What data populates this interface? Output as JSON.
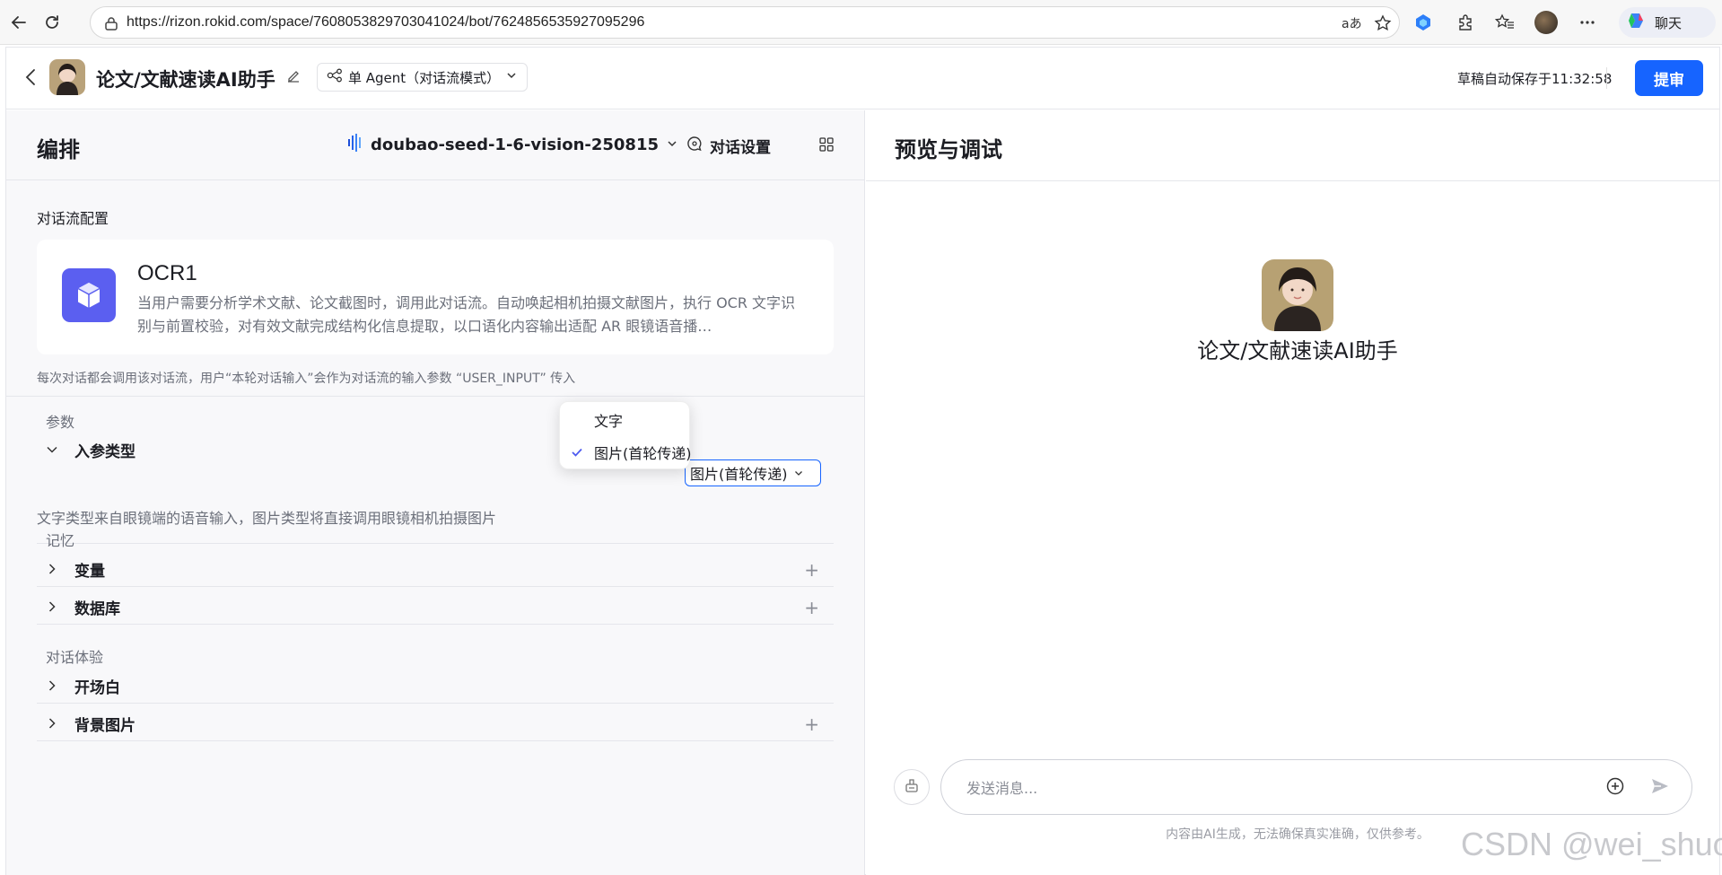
{
  "browser": {
    "url": "https://rizon.rokid.com/space/7608053829703041024/bot/7624856535927095296",
    "chat_label": "聊天"
  },
  "header": {
    "bot_title": "论文/文献速读AI助手",
    "mode": "单 Agent（对话流模式）",
    "autosave": "草稿自动保存于11:32:58",
    "submit_label": "提审"
  },
  "left": {
    "title": "编排",
    "model": "doubao-seed-1-6-vision-250815",
    "dialog_settings": "对话设置",
    "flow_section": "对话流配置",
    "flow": {
      "name": "OCR1",
      "description": "当用户需要分析学术文献、论文截图时，调用此对话流。自动唤起相机拍摄文献图片，执行 OCR 文字识别与前置校验，对有效文献完成结构化信息提取，以口语化内容输出适配 AR 眼镜语音播…"
    },
    "flow_hint": "每次对话都会调用该对话流，用户“本轮对话输入”会作为对话流的输入参数 “USER_INPUT” 传入",
    "params_label": "参数",
    "input_type_label": "入参类型",
    "input_type_value": "图片(首轮传递)",
    "input_type_desc": "文字类型来自眼镜端的语音输入，图片类型将直接调用眼镜相机拍摄图片",
    "dropdown_options": [
      "文字",
      "图片(首轮传递)"
    ],
    "memory_label": "记忆",
    "variables_label": "变量",
    "database_label": "数据库",
    "experience_label": "对话体验",
    "opening_label": "开场白",
    "background_label": "背景图片",
    "plus": "+"
  },
  "right": {
    "title": "预览与调试",
    "bot_name": "论文/文献速读AI助手",
    "message_placeholder": "发送消息...",
    "disclaimer": "内容由AI生成，无法确保真实准确，仅供参考。"
  },
  "watermark": "CSDN @wei_shuo",
  "colors": {
    "accent": "#1664ff",
    "flow_icon": "#5b5ff0"
  }
}
